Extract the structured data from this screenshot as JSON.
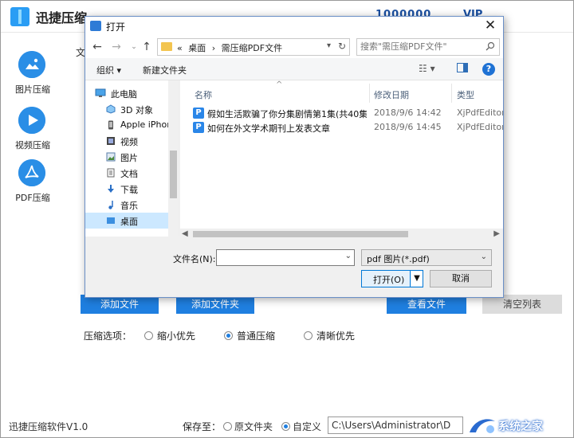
{
  "app": {
    "title": "迅捷压缩",
    "title_right": "1000000",
    "vip_label": "VIP",
    "content_tab": "文",
    "nav": [
      {
        "label": "图片压缩",
        "icon": "image-icon"
      },
      {
        "label": "视频压缩",
        "icon": "play-icon"
      },
      {
        "label": "PDF压缩",
        "icon": "pdf-icon"
      }
    ],
    "buttons": {
      "add_file": "添加文件",
      "add_folder": "添加文件夹",
      "view_file": "查看文件",
      "clear_list": "清空列表"
    },
    "compress": {
      "label": "压缩选项：",
      "options": [
        "缩小优先",
        "普通压缩",
        "清晰优先"
      ],
      "selected": "普通压缩"
    },
    "status": {
      "version": "迅捷压缩软件V1.0",
      "save_to": "保存至：",
      "save_options": [
        "原文件夹",
        "自定义"
      ],
      "selected_save": "自定义",
      "path": "C:\\Users\\Administrator\\D"
    },
    "watermark": "系统之家",
    "colors": {
      "accent": "#1f7fe0",
      "dialog_border": "#6a8fc7"
    }
  },
  "dialog": {
    "title": "打开",
    "close": "✕",
    "address": {
      "prefix": "«",
      "crumbs": [
        "桌面",
        "需压缩PDF文件"
      ],
      "separator": "›"
    },
    "search_placeholder": "搜索\"需压缩PDF文件\"",
    "toolbar": {
      "organize": "组织 ▾",
      "new_folder": "新建文件夹",
      "view": "☷ ▾",
      "help": "?"
    },
    "tree": [
      {
        "label": "此电脑",
        "icon": "computer-icon"
      },
      {
        "label": "3D 对象",
        "icon": "cube-icon"
      },
      {
        "label": "Apple iPhone",
        "icon": "phone-icon"
      },
      {
        "label": "视频",
        "icon": "video-icon"
      },
      {
        "label": "图片",
        "icon": "picture-icon"
      },
      {
        "label": "文档",
        "icon": "document-icon"
      },
      {
        "label": "下载",
        "icon": "download-icon"
      },
      {
        "label": "音乐",
        "icon": "music-icon"
      },
      {
        "label": "桌面",
        "icon": "desktop-icon"
      }
    ],
    "selected_tree": "桌面",
    "columns": [
      "名称",
      "修改日期",
      "类型"
    ],
    "files": [
      {
        "name": "假如生活欺骗了你分集剧情第1集(共40集...",
        "date": "2018/9/6 14:42",
        "type": "XjPdfEditorN",
        "icon": "P"
      },
      {
        "name": "如何在外文学术期刊上发表文章",
        "date": "2018/9/6 14:45",
        "type": "XjPdfEditorN",
        "icon": "P"
      }
    ],
    "filename_label": "文件名(N):",
    "filename_value": "",
    "filetype": "pdf 图片(*.pdf)",
    "open_label": "打开(O)",
    "cancel_label": "取消"
  }
}
